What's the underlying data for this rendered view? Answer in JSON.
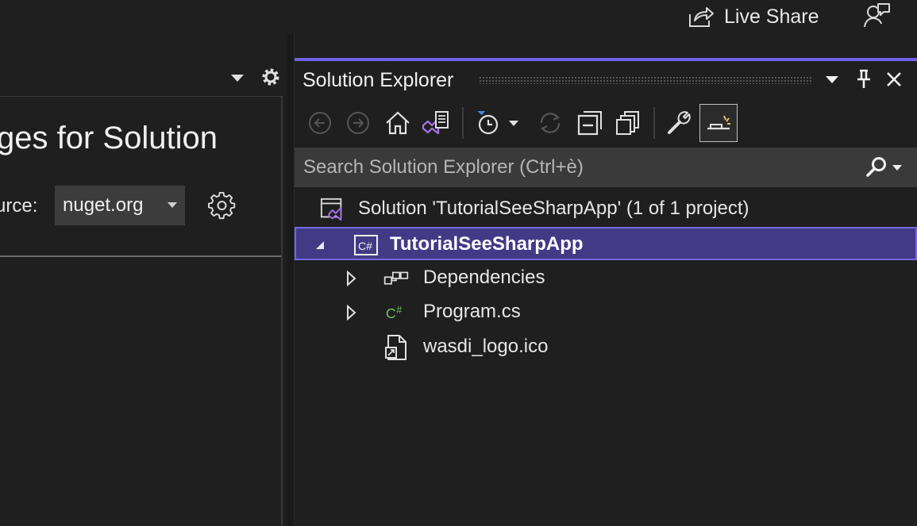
{
  "topbar": {
    "live_share_label": "Live Share",
    "live_share_icon": "share-arrow-icon",
    "feedback_icon": "person-feedback-icon"
  },
  "nuget": {
    "title": "ges for Solution",
    "source_label": "urce:",
    "source_value": "nuget.org"
  },
  "solution_explorer": {
    "title": "Solution Explorer",
    "search_placeholder": "Search Solution Explorer (Ctrl+è)",
    "accent_color": "#7160e8",
    "selection_color": "#433a86",
    "tree": {
      "solution_label": "Solution 'TutorialSeeSharpApp' (1 of 1 project)",
      "project_label": "TutorialSeeSharpApp",
      "dependencies_label": "Dependencies",
      "program_label": "Program.cs",
      "logo_label": "wasdi_logo.ico"
    }
  }
}
